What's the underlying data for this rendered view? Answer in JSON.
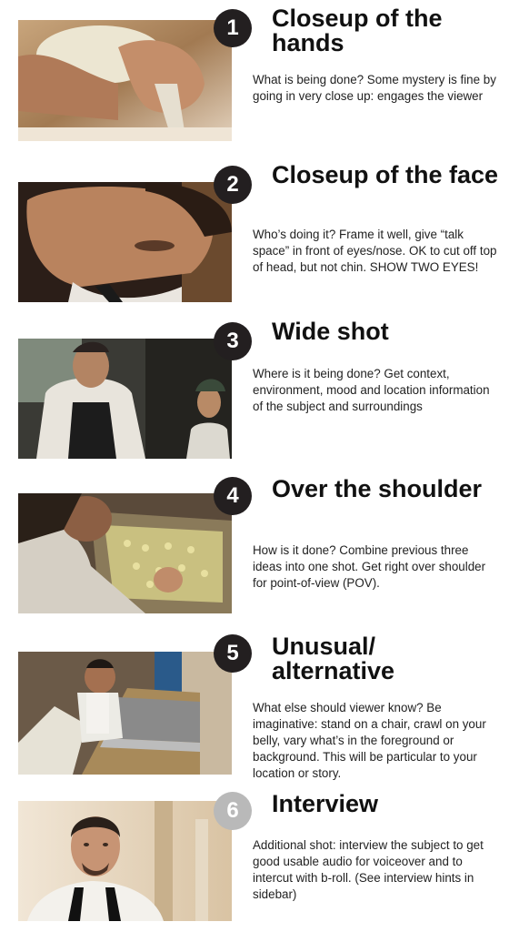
{
  "steps": [
    {
      "number": "1",
      "title": "Closeup of the hands",
      "description": "What is being done? Some mystery is fine by going in very close up: engages the viewer"
    },
    {
      "number": "2",
      "title": "Closeup of the face",
      "description": "Who’s doing it? Frame it well, give “talk space” in front of eyes/nose. OK to cut off top of head, but not chin. SHOW TWO EYES!"
    },
    {
      "number": "3",
      "title": "Wide shot",
      "description": "Where is it being done? Get context, environment, mood and location information of the subject and surroundings"
    },
    {
      "number": "4",
      "title": "Over the shoulder",
      "description": "How is it done? Combine previous three ideas into one shot. Get right over shoulder for point-of-view (POV)."
    },
    {
      "number": "5",
      "title": "Unusual/ alternative",
      "description": "What else should viewer know? Be imaginative: stand on a chair, crawl on your belly, vary what’s in the foreground or background. This will be particular to your location or story."
    },
    {
      "number": "6",
      "title": "Interview",
      "description": "Additional shot: interview the subject to get good usable audio for voiceover and to intercut with b-roll. (See interview hints in sidebar)"
    }
  ],
  "colors": {
    "badge_dark": "#231f20",
    "badge_light": "#b9b9b9",
    "text": "#1a1a1a"
  }
}
